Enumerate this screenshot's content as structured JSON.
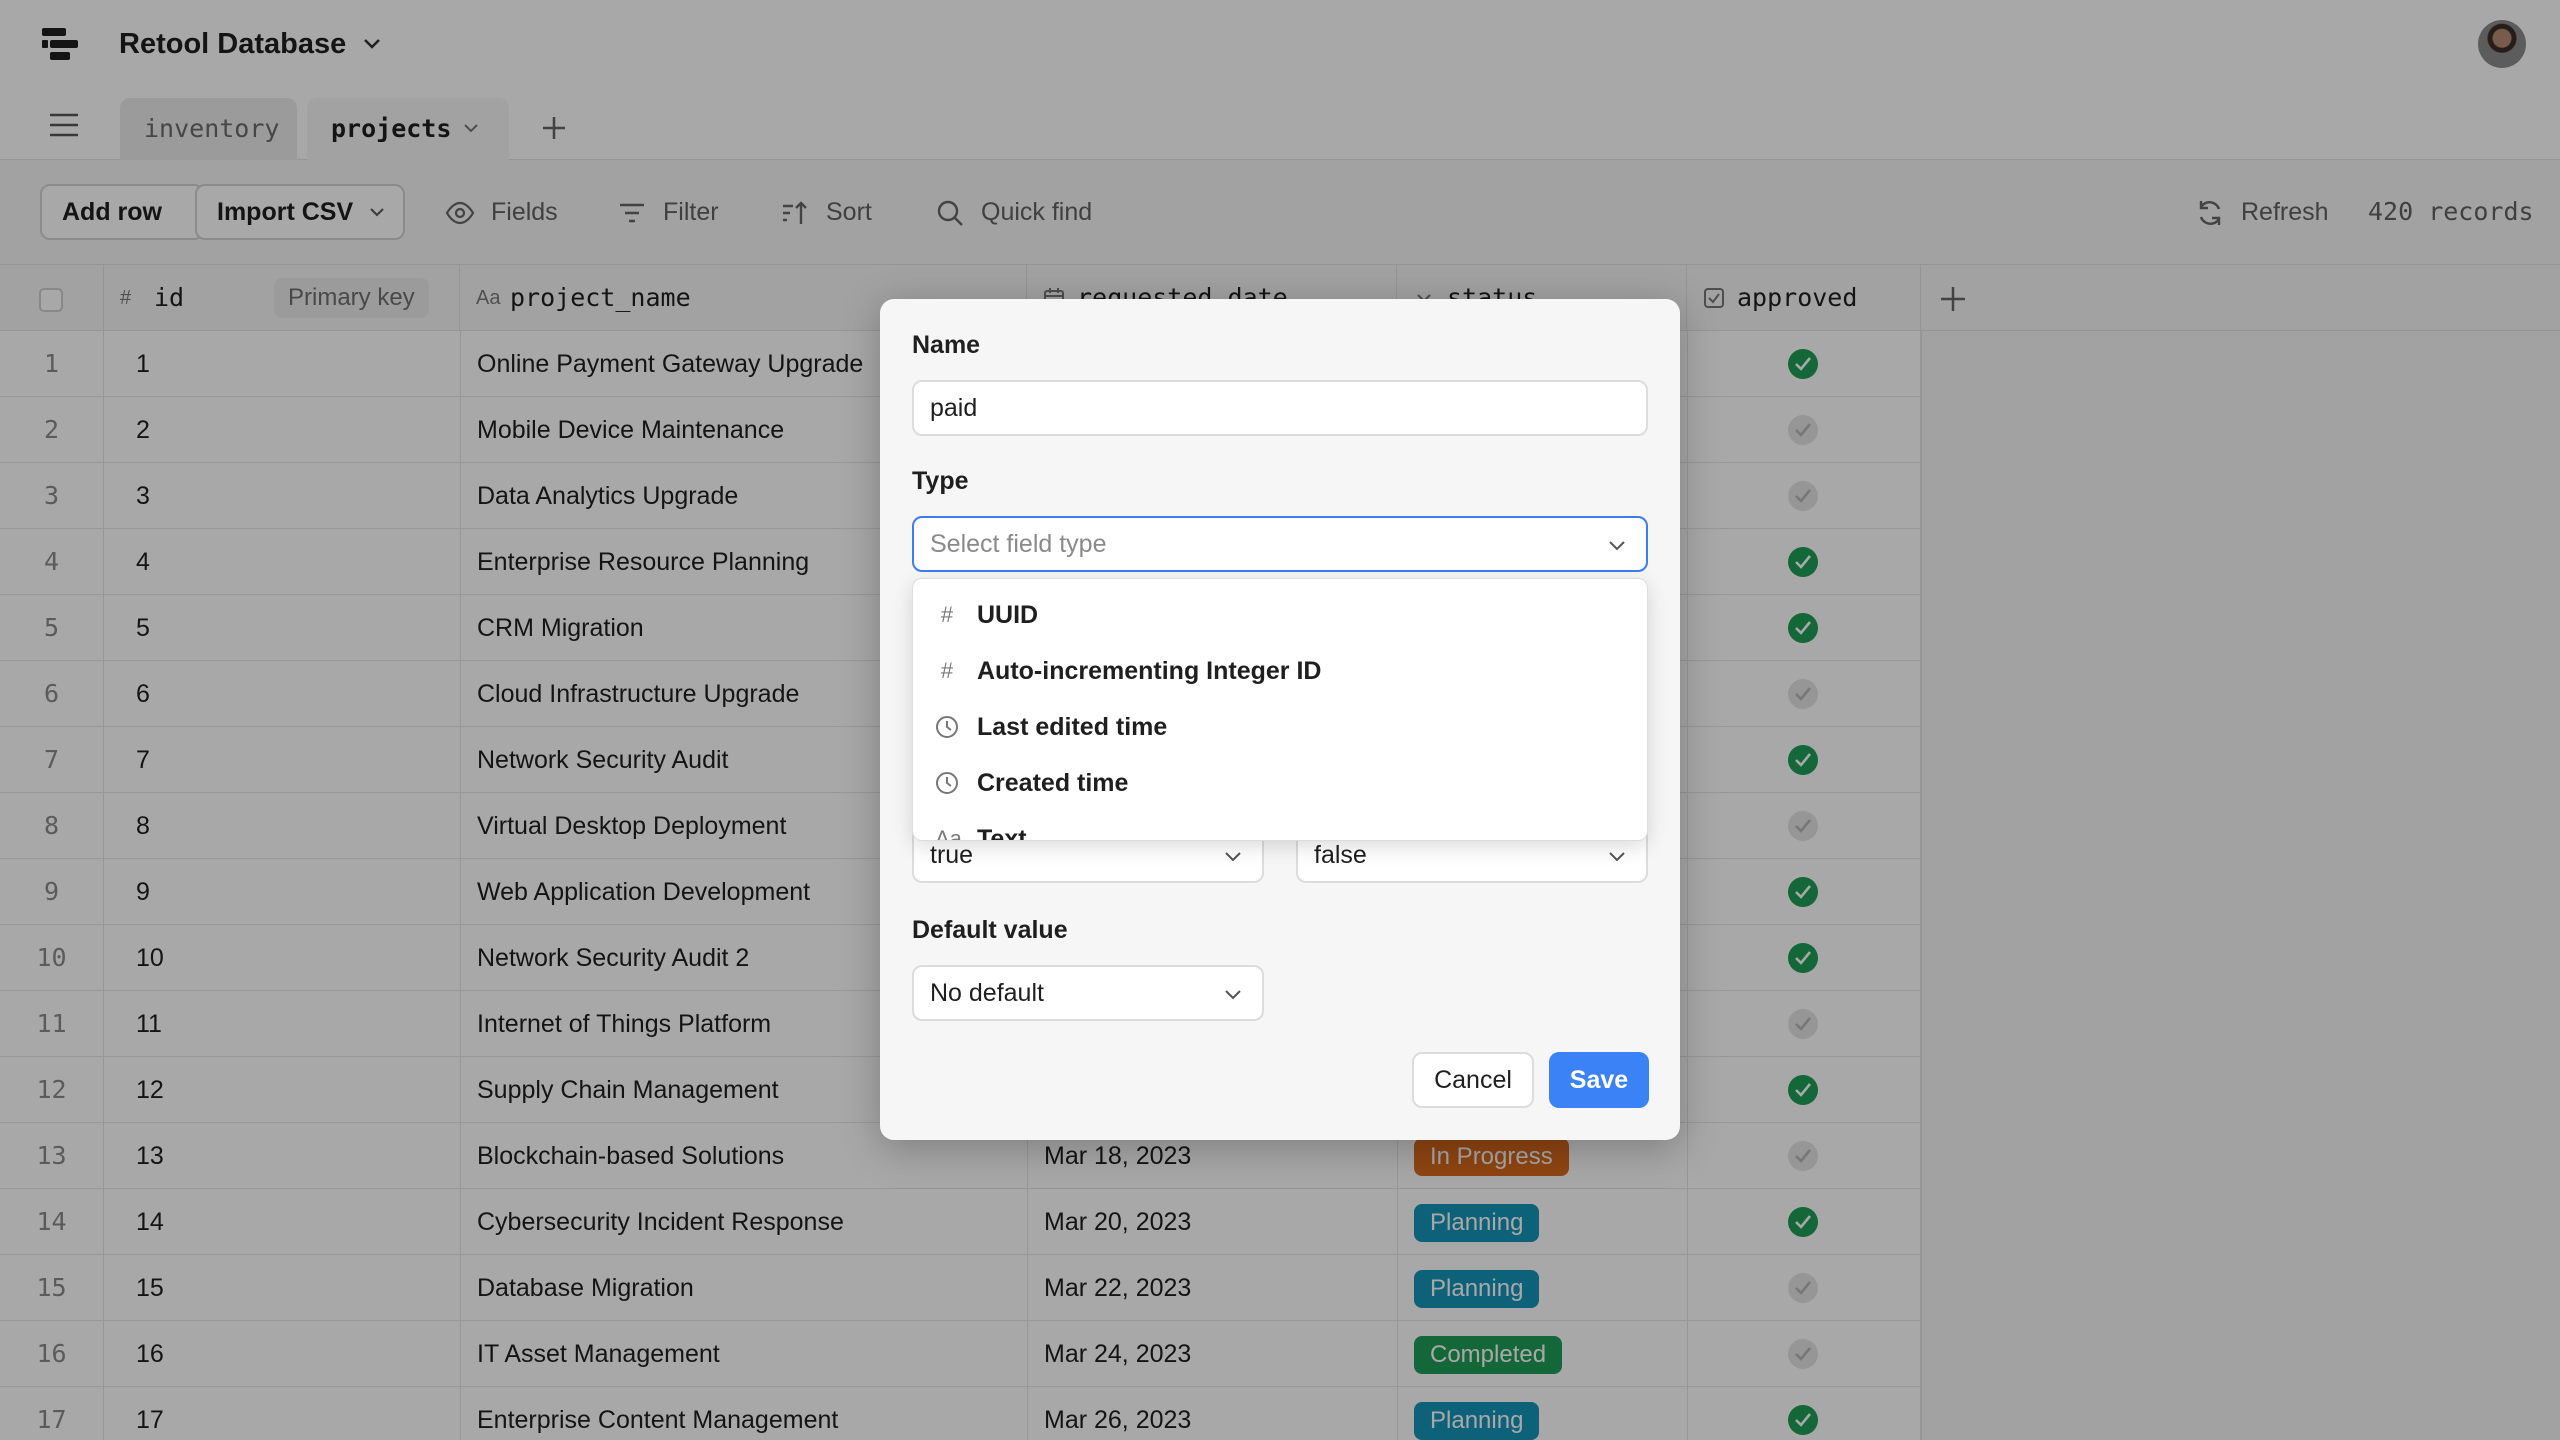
{
  "app": {
    "title": "Retool Database"
  },
  "tabs": [
    {
      "label": "inventory"
    },
    {
      "label": "projects"
    }
  ],
  "toolbar": {
    "add_row": "Add row",
    "import_csv": "Import CSV",
    "fields": "Fields",
    "filter": "Filter",
    "sort": "Sort",
    "quick_find": "Quick find",
    "refresh": "Refresh",
    "records": "420 records"
  },
  "columns": {
    "id": {
      "icon": "#",
      "label": "id",
      "badge": "Primary key"
    },
    "project_name": {
      "icon": "Aa",
      "label": "project_name"
    },
    "requested_date": {
      "label": "requested_date"
    },
    "status": {
      "label": "status"
    },
    "approved": {
      "label": "approved"
    }
  },
  "status_colors": {
    "In Progress": "#d96a1c",
    "Planning": "#1595b8",
    "Completed": "#1f9d55"
  },
  "rows": [
    {
      "num": "1",
      "id": "1",
      "name": "Online Payment Gateway Upgrade",
      "date": "",
      "status": "",
      "approved": true
    },
    {
      "num": "2",
      "id": "2",
      "name": "Mobile Device Maintenance",
      "date": "",
      "status": "",
      "approved": false
    },
    {
      "num": "3",
      "id": "3",
      "name": "Data Analytics Upgrade",
      "date": "",
      "status": "",
      "approved": false
    },
    {
      "num": "4",
      "id": "4",
      "name": "Enterprise Resource Planning",
      "date": "",
      "status": "",
      "approved": true
    },
    {
      "num": "5",
      "id": "5",
      "name": "CRM Migration",
      "date": "",
      "status": "",
      "approved": true
    },
    {
      "num": "6",
      "id": "6",
      "name": "Cloud Infrastructure Upgrade",
      "date": "",
      "status": "",
      "approved": false
    },
    {
      "num": "7",
      "id": "7",
      "name": "Network Security Audit",
      "date": "",
      "status": "",
      "approved": true
    },
    {
      "num": "8",
      "id": "8",
      "name": "Virtual Desktop Deployment",
      "date": "",
      "status": "",
      "approved": false
    },
    {
      "num": "9",
      "id": "9",
      "name": "Web Application Development",
      "date": "",
      "status": "",
      "approved": true
    },
    {
      "num": "10",
      "id": "10",
      "name": "Network Security Audit 2",
      "date": "",
      "status": "",
      "approved": true
    },
    {
      "num": "11",
      "id": "11",
      "name": "Internet of Things Platform",
      "date": "",
      "status": "",
      "approved": false
    },
    {
      "num": "12",
      "id": "12",
      "name": "Supply Chain Management",
      "date": "",
      "status": "",
      "approved": true
    },
    {
      "num": "13",
      "id": "13",
      "name": "Blockchain-based Solutions",
      "date": "Mar 18, 2023",
      "status": "In Progress",
      "approved": false
    },
    {
      "num": "14",
      "id": "14",
      "name": "Cybersecurity Incident Response",
      "date": "Mar 20, 2023",
      "status": "Planning",
      "approved": true
    },
    {
      "num": "15",
      "id": "15",
      "name": "Database Migration",
      "date": "Mar 22, 2023",
      "status": "Planning",
      "approved": false
    },
    {
      "num": "16",
      "id": "16",
      "name": "IT Asset Management",
      "date": "Mar 24, 2023",
      "status": "Completed",
      "approved": false
    },
    {
      "num": "17",
      "id": "17",
      "name": "Enterprise Content Management",
      "date": "Mar 26, 2023",
      "status": "Planning",
      "approved": true
    }
  ],
  "dialog": {
    "name_label": "Name",
    "name_value": "paid",
    "type_label": "Type",
    "type_placeholder": "Select field type",
    "true_value": "true",
    "false_value": "false",
    "default_label": "Default value",
    "default_value": "No default",
    "cancel": "Cancel",
    "save": "Save"
  },
  "type_options": [
    {
      "icon": "#",
      "label": "UUID"
    },
    {
      "icon": "#",
      "label": "Auto-incrementing Integer ID"
    },
    {
      "icon": "clock",
      "label": "Last edited time"
    },
    {
      "icon": "clock",
      "label": "Created time"
    },
    {
      "icon": "Aa",
      "label": "Text"
    }
  ]
}
